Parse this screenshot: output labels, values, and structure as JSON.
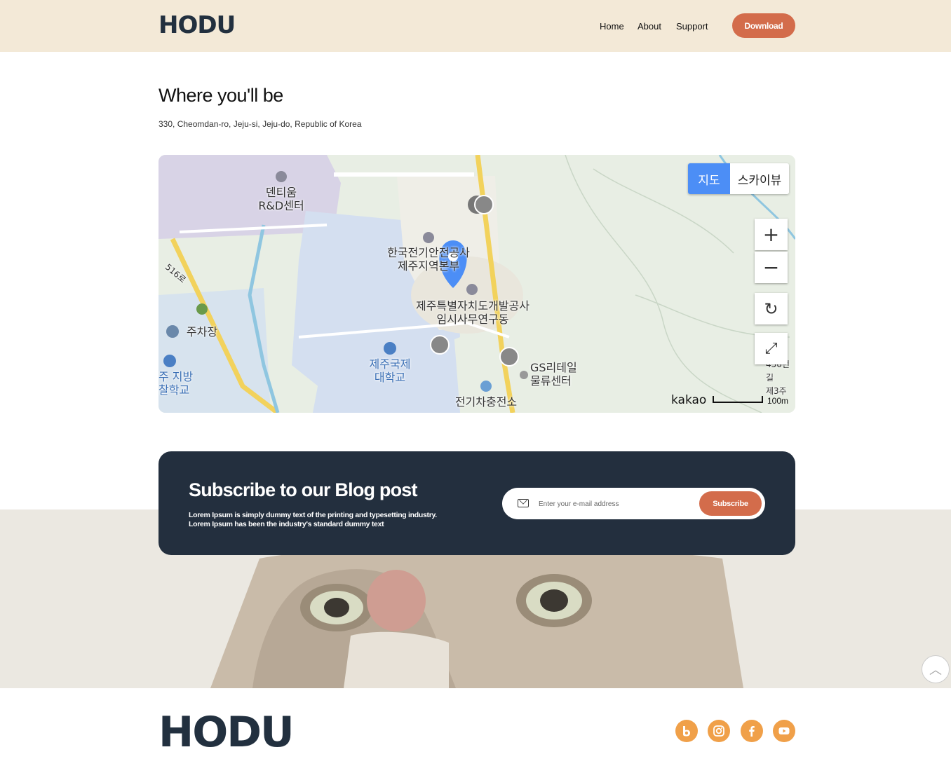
{
  "header": {
    "logo": "HODU",
    "nav": [
      "Home",
      "About",
      "Support"
    ],
    "download_label": "Download"
  },
  "location": {
    "title": "Where you'll be",
    "address": "330, Cheomdan-ro, Jeju-si, Jeju-do, Republic of Korea"
  },
  "map": {
    "type_buttons": [
      "지도",
      "스카이뷰"
    ],
    "labels": {
      "rnd": "덴티움\nR&D센터",
      "kepco": "한국전기안전공사\n제주지역본부",
      "jdc": "제주특별자치도개발공사\n임시사무연구동",
      "school": "제주국제\n대학교",
      "parking": "주차장",
      "police": "주 지방\n찰학교",
      "gs": "GS리테일\n물류센터",
      "ev": "전기차충전소",
      "road": "516로",
      "edge": "450번길\n제3주"
    },
    "zoom_in": "+",
    "zoom_out": "−",
    "brand": "kakao",
    "scale_label": "100m"
  },
  "subscribe": {
    "title": "Subscribe to our Blog post",
    "text": "Lorem Ipsum is simply dummy text of the printing and typesetting industry. Lorem Ipsum has been the industry's standard dummy text",
    "placeholder": "Enter your e-mail address",
    "button": "Subscribe"
  },
  "footer": {
    "logo": "HODU",
    "social": [
      "blog-icon",
      "instagram-icon",
      "facebook-icon",
      "youtube-icon"
    ]
  },
  "colors": {
    "header_bg": "#f3e9d7",
    "accent": "#d36c4b",
    "dark": "#232f3e",
    "social": "#f0a049",
    "map_toggle": "#4c8ef6"
  }
}
